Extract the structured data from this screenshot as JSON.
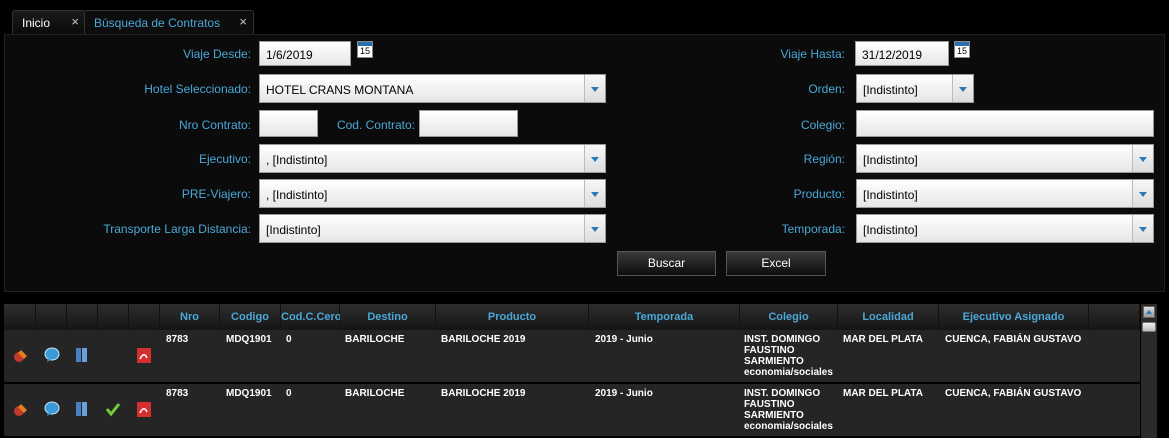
{
  "tabs": [
    {
      "label": "Inicio",
      "close": "×"
    },
    {
      "label": "Búsqueda de Contratos",
      "close": "×"
    }
  ],
  "form": {
    "viaje_desde": {
      "label": "Viaje Desde:",
      "value": "1/6/2019"
    },
    "viaje_hasta": {
      "label": "Viaje Hasta:",
      "value": "31/12/2019"
    },
    "hotel": {
      "label": "Hotel Seleccionado:",
      "value": "HOTEL CRANS MONTANA"
    },
    "orden": {
      "label": "Orden:",
      "value": "[Indistinto]"
    },
    "nro_contrato": {
      "label": "Nro Contrato:",
      "value": ""
    },
    "cod_contrato": {
      "label": "Cod. Contrato:",
      "value": ""
    },
    "colegio": {
      "label": "Colegio:",
      "value": ""
    },
    "ejecutivo": {
      "label": "Ejecutivo:",
      "value": ", [Indistinto]"
    },
    "region": {
      "label": "Región:",
      "value": "[Indistinto]"
    },
    "pre_viajero": {
      "label": "PRE-Viajero:",
      "value": ", [Indistinto]"
    },
    "producto": {
      "label": "Producto:",
      "value": "[Indistinto]"
    },
    "transporte": {
      "label": "Transporte Larga Distancia:",
      "value": "[Indistinto]"
    },
    "temporada": {
      "label": "Temporada:",
      "value": "[Indistinto]"
    },
    "calendar_day": "15"
  },
  "buttons": {
    "buscar": "Buscar",
    "excel": "Excel"
  },
  "table": {
    "headers": [
      "Nro",
      "Codigo",
      "Cod.C.Cero",
      "Destino",
      "Producto",
      "Temporada",
      "Colegio",
      "Localidad",
      "Ejecutivo Asignado"
    ],
    "rows": [
      {
        "nro": "8783",
        "codigo": "MDQ1901",
        "cod_cero": "0",
        "destino": "BARILOCHE",
        "producto": "BARILOCHE 2019",
        "temporada": "2019 - Junio",
        "colegio": "INST. DOMINGO FAUSTINO SARMIENTO economia/sociales",
        "localidad": "MAR DEL PLATA",
        "ejecutivo": "CUENCA, FABIÁN GUSTAVO",
        "checked": false
      },
      {
        "nro": "8783",
        "codigo": "MDQ1901",
        "cod_cero": "0",
        "destino": "BARILOCHE",
        "producto": "BARILOCHE 2019",
        "temporada": "2019 - Junio",
        "colegio": "INST. DOMINGO FAUSTINO SARMIENTO economia/sociales",
        "localidad": "MAR DEL PLATA",
        "ejecutivo": "CUENCA, FABIÁN GUSTAVO",
        "checked": true
      }
    ]
  },
  "colors": {
    "accent": "#4aa8d8",
    "background": "#000000",
    "row": "#252525"
  }
}
